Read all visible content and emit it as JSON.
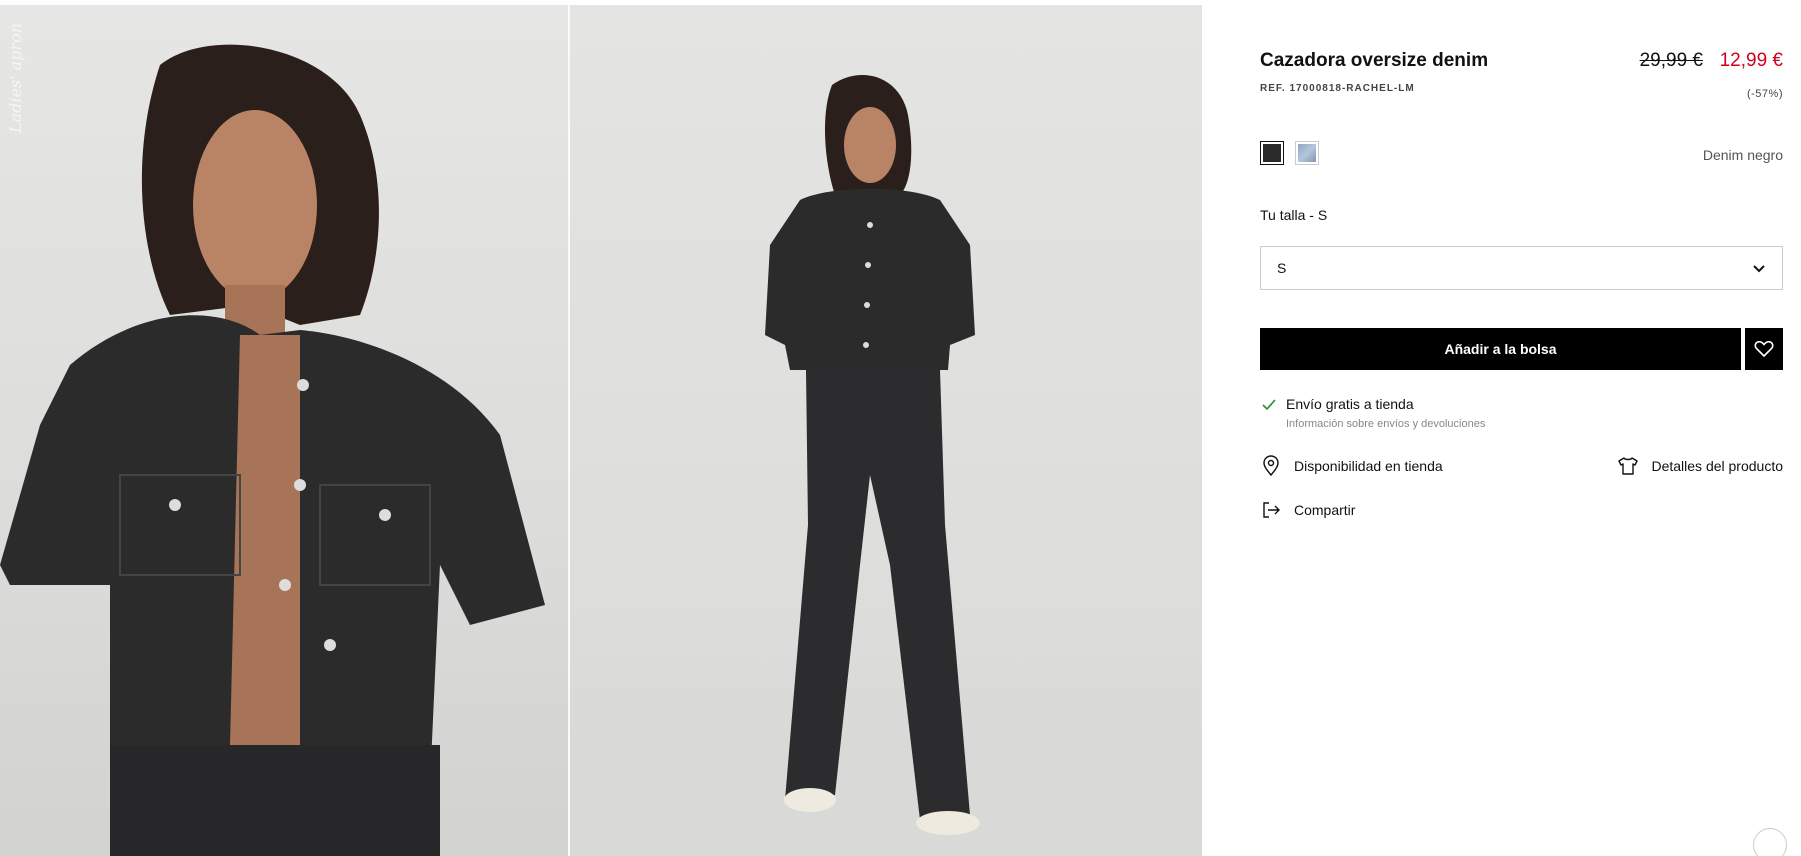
{
  "gallery": {
    "watermark": "Ladies' apron",
    "images": [
      {
        "alt": "Cazadora oversize denim - close up"
      },
      {
        "alt": "Cazadora oversize denim - full look"
      }
    ]
  },
  "product": {
    "title": "Cazadora oversize denim",
    "ref": "REF. 17000818-RACHEL-LM",
    "price_old": "29,99 €",
    "price_new": "12,99 €",
    "discount": "(-57%)",
    "color_name": "Denim negro",
    "swatches": [
      {
        "name": "Denim negro",
        "color": "#2a2a2a",
        "selected": true
      },
      {
        "name": "Denim claro",
        "color": "#9fb4cd",
        "selected": false
      }
    ]
  },
  "size": {
    "label": "Tu talla - S",
    "selected": "S"
  },
  "actions": {
    "add_to_bag": "Añadir a la bolsa",
    "favorite_icon": "heart-icon"
  },
  "shipping": {
    "title": "Envío gratis a tienda",
    "subtitle": "Información sobre envíos y devoluciones"
  },
  "links": {
    "availability": "Disponibilidad en tienda",
    "details": "Detalles del producto",
    "share": "Compartir"
  },
  "colors": {
    "accent_red": "#d0021b",
    "button_black": "#000000",
    "check_green": "#2a8a3e"
  }
}
